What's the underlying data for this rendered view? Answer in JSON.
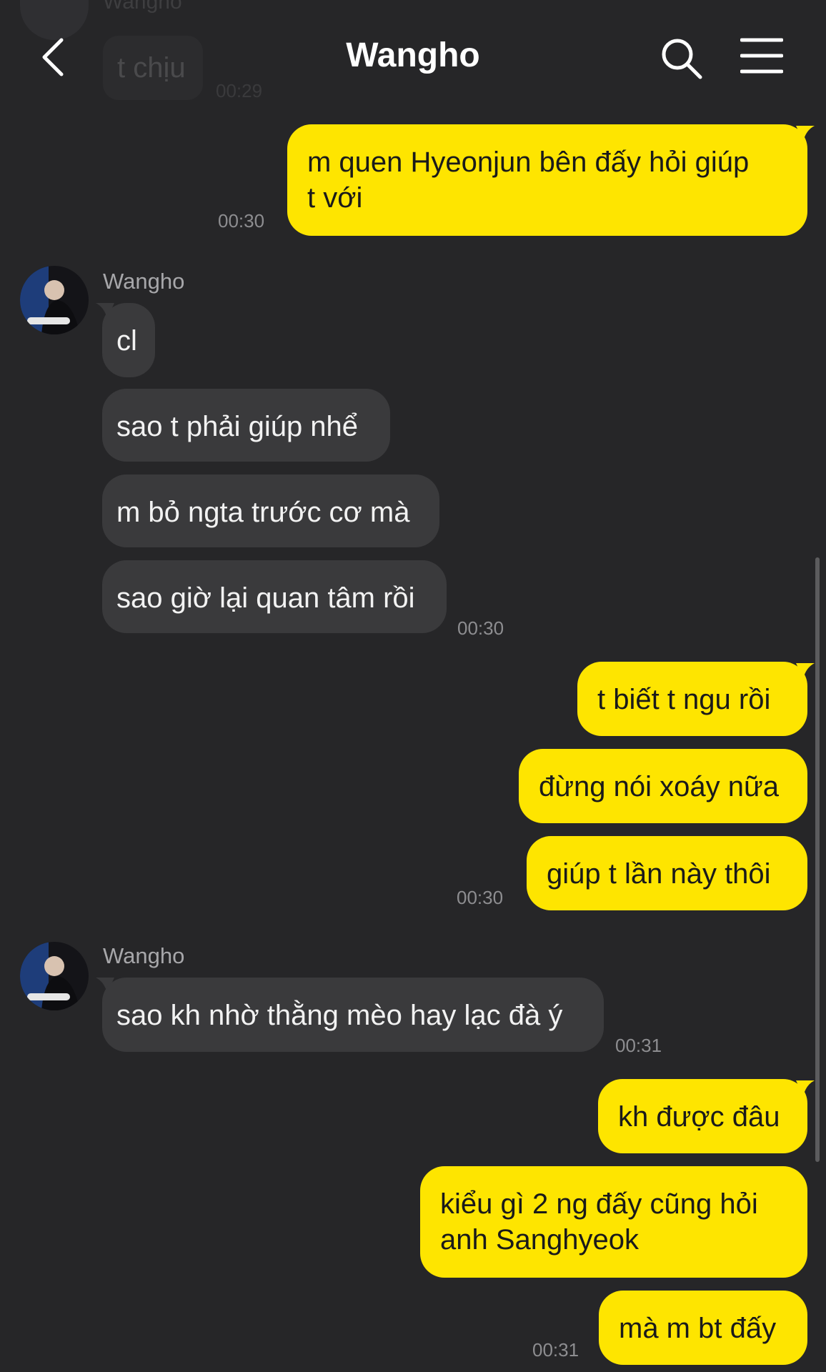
{
  "header": {
    "title": "Wangho",
    "back_icon": "chevron-left-icon",
    "search_icon": "search-icon",
    "menu_icon": "hamburger-menu-icon"
  },
  "colors": {
    "background": "#262628",
    "outgoing_bubble": "#fee500",
    "incoming_bubble": "#3a3a3c",
    "timestamp": "#8d8d90"
  },
  "ghost": {
    "name": "Wangho",
    "text": "t chịu",
    "time": "00:29"
  },
  "messages": {
    "m1": {
      "text_line1": "m quen Hyeonjun bên đấy hỏi giúp",
      "text_line2": "t với",
      "time": "00:30"
    },
    "group2": {
      "sender": "Wangho",
      "m2": {
        "text": "cl"
      },
      "m3": {
        "text": "sao t phải giúp nhể"
      },
      "m4": {
        "text": "m bỏ ngta trước cơ mà"
      },
      "m5": {
        "text": "sao giờ lại quan tâm rồi"
      },
      "time": "00:30"
    },
    "group3": {
      "m6": {
        "text": "t biết t ngu rồi"
      },
      "m7": {
        "text": "đừng nói xoáy nữa"
      },
      "m8": {
        "text": "giúp t lần này thôi"
      },
      "time": "00:30"
    },
    "group4": {
      "sender": "Wangho",
      "m9": {
        "text": "sao kh nhờ thằng mèo hay lạc đà ý"
      },
      "time": "00:31"
    },
    "group5": {
      "m10": {
        "text": "kh được đâu"
      },
      "m11": {
        "text_line1": "kiểu gì 2 ng đấy cũng hỏi",
        "text_line2": "anh Sanghyeok"
      },
      "m12": {
        "text": "mà m bt đấy"
      },
      "time": "00:31"
    }
  }
}
